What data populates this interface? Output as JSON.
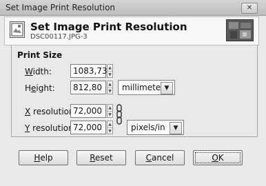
{
  "window": {
    "title": "Set Image Print Resolution",
    "close_glyph": "✕"
  },
  "header": {
    "title": "Set Image Print Resolution",
    "subtitle": "DSC00117.JPG-3",
    "icon": "print-size-icon"
  },
  "print_size": {
    "section_title": "Print Size",
    "width": {
      "mnemonic": "W",
      "label_rest": "idth:",
      "value": "1083,73"
    },
    "height": {
      "mnemonic": "e",
      "label_pre": "H",
      "label_rest": "ight:",
      "value": "812,80"
    },
    "size_unit": "millimeters",
    "x_resolution": {
      "mnemonic": "X",
      "label_rest": " resolution:",
      "value": "72,000"
    },
    "y_resolution": {
      "mnemonic": "Y",
      "label_rest": " resolution:",
      "value": "72,000"
    },
    "resolution_unit": "pixels/in"
  },
  "buttons": {
    "help": {
      "mnemonic": "H",
      "rest": "elp"
    },
    "reset": {
      "mnemonic": "R",
      "rest": "eset"
    },
    "cancel": {
      "mnemonic": "C",
      "rest": "ancel"
    },
    "ok": {
      "mnemonic": "O",
      "rest": "K"
    }
  },
  "colors": {
    "window_bg": "#e9e9e9",
    "header_bg": "#f7f7f7",
    "titlebar": "#c8c8c8"
  }
}
